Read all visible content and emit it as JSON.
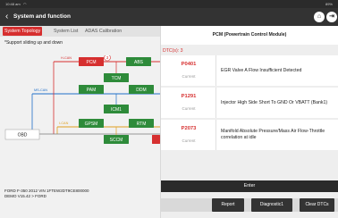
{
  "status": {
    "time": "10:48 am",
    "wifi": "wifi",
    "battery": "89%"
  },
  "titlebar": {
    "title": "System and function",
    "back_icon": "‹",
    "home_icon": "⌂",
    "exit_icon": "⇥"
  },
  "tabs": [
    "System Topology",
    "System List",
    "ADAS Calibration"
  ],
  "support_text": "*Support sliding up and down",
  "topology": {
    "bus_labels": [
      "H-CAN",
      "MS-CAN",
      "I-CAN"
    ],
    "modules": [
      "PCM",
      "ABS",
      "TCM",
      "PAM",
      "DDM",
      "ICM1",
      "GPSM",
      "RTM",
      "SCCM"
    ],
    "badge": "3",
    "obd": "OBD",
    "colors": {
      "red": "#d62f2f",
      "green": "#2e8b3a"
    }
  },
  "vehicle": {
    "line1": "FORD  F-350  2012  VIN  1FTEW2DT9CE800000",
    "line2": "DEMO V15.42 >  FORD"
  },
  "right": {
    "header": "PCM (Powertrain Control Module)",
    "dtc_count": "DTC(s): 3",
    "dtcs": [
      {
        "code": "P0401",
        "state": "Current",
        "desc": "EGR Valve A Flow Insufficient Detected"
      },
      {
        "code": "P1291",
        "state": "Current",
        "desc": "Injector High Side Short To GND Or VBATT (Bank1)"
      },
      {
        "code": "P2073",
        "state": "Current",
        "desc": "Manifold Absolute Pressure/Mass Air Flow-Throttle correlation at idle"
      }
    ]
  },
  "buttons": {
    "enter": "Enter",
    "report": "Report",
    "diagnostic": "Diagnostic1",
    "clear": "Clear DTCs"
  }
}
